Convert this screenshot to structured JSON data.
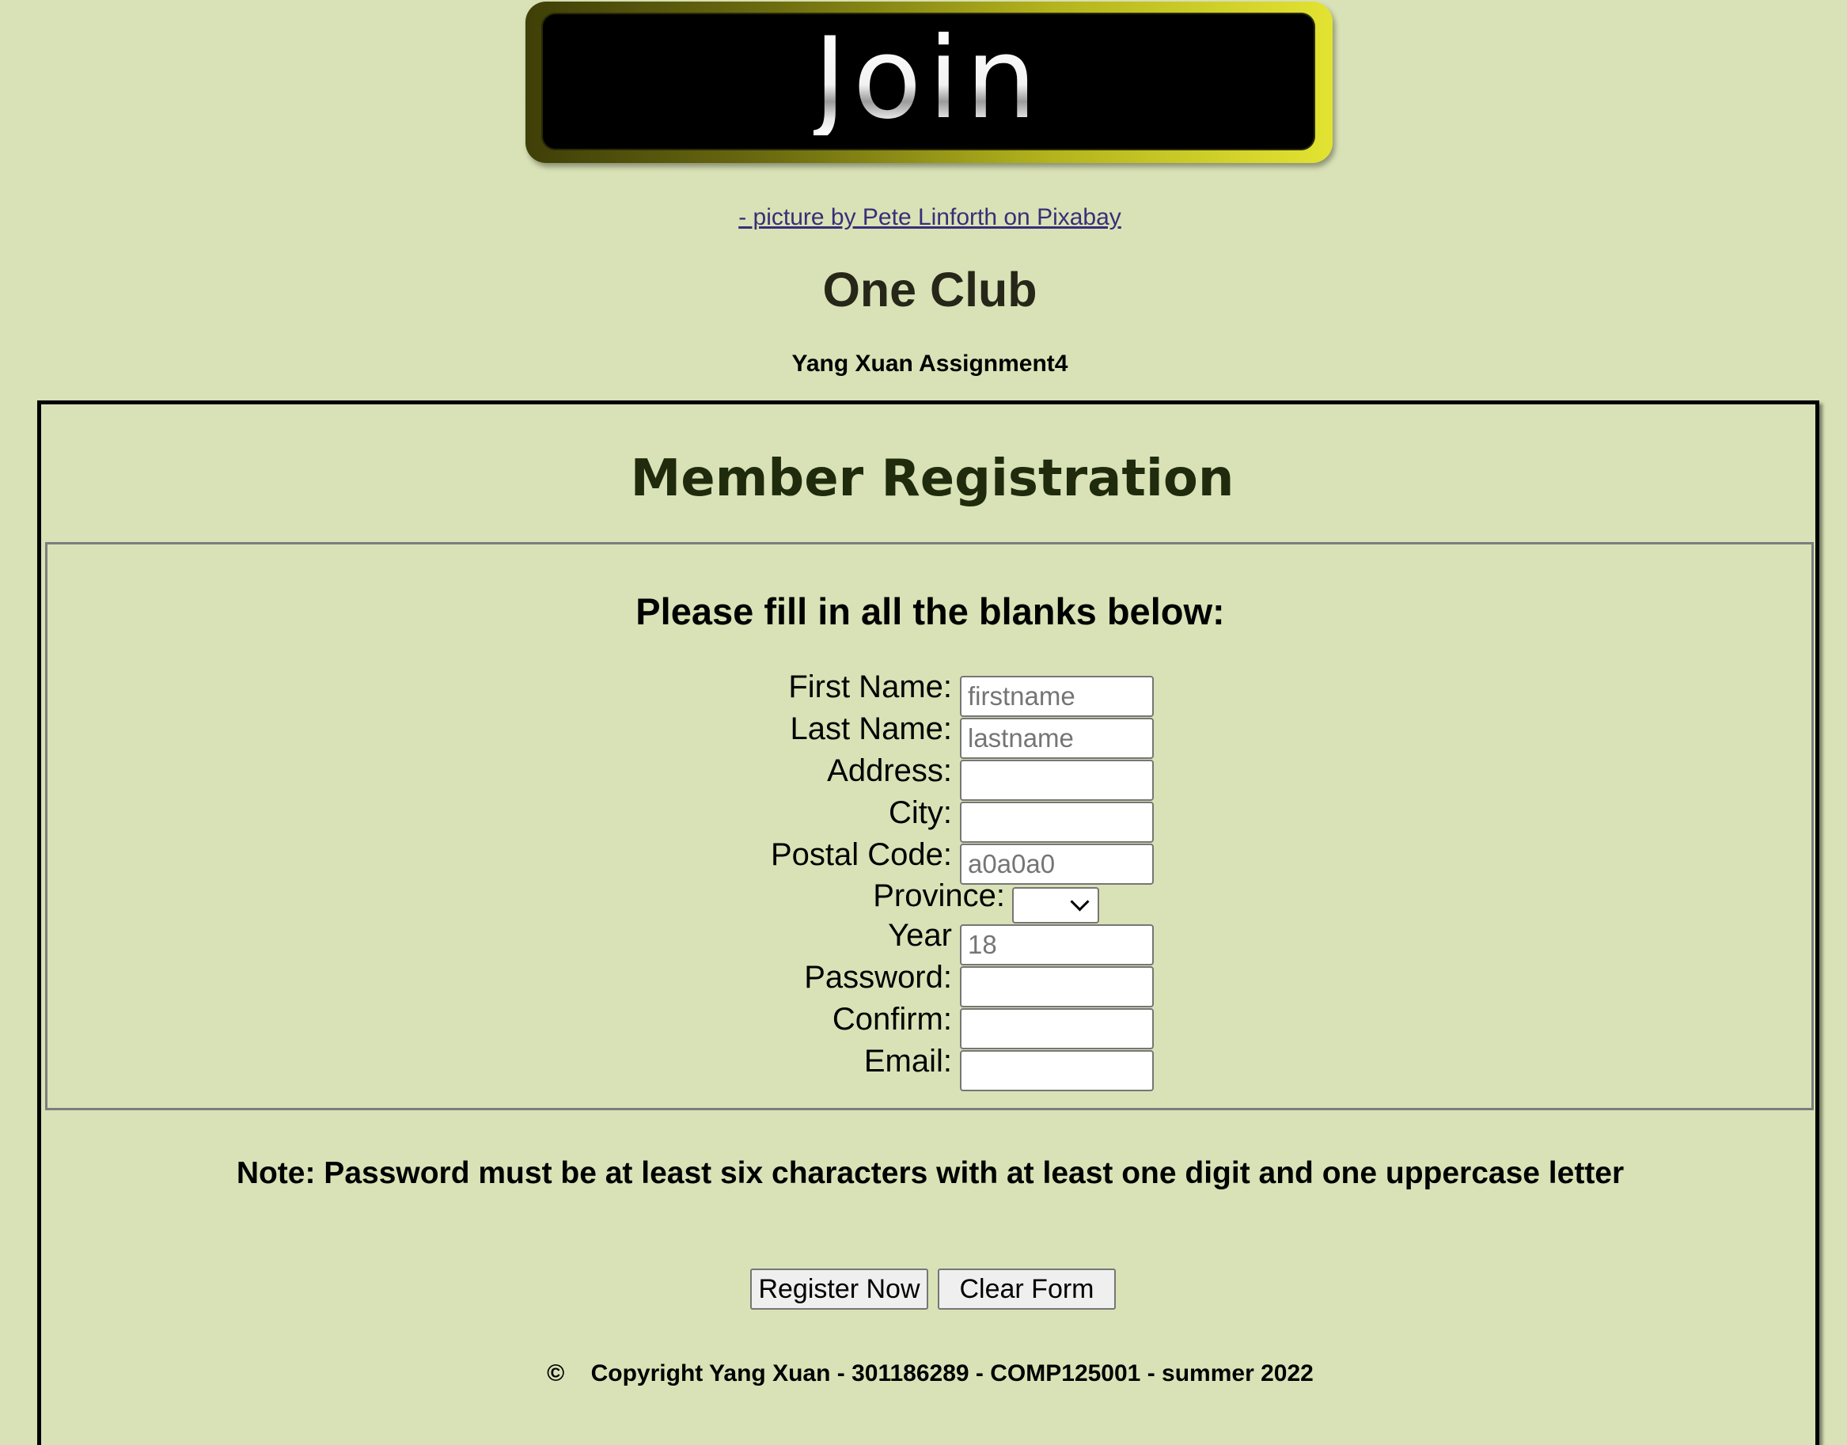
{
  "banner": {
    "text": "Join"
  },
  "credit": {
    "link_text": "- picture by Pete Linforth on Pixabay"
  },
  "header": {
    "title": "One Club",
    "subtitle": "Yang Xuan Assignment4"
  },
  "form": {
    "title": "Member Registration",
    "instructions": "Please fill in all the blanks below:",
    "fields": {
      "first_name": {
        "label": "First Name:",
        "value": "",
        "placeholder": "firstname"
      },
      "last_name": {
        "label": "Last Name:",
        "value": "",
        "placeholder": "lastname"
      },
      "address": {
        "label": "Address:",
        "value": "",
        "placeholder": ""
      },
      "city": {
        "label": "City:",
        "value": "",
        "placeholder": ""
      },
      "postal_code": {
        "label": "Postal Code:",
        "value": "",
        "placeholder": "a0a0a0"
      },
      "province": {
        "label": "Province:",
        "selected": ""
      },
      "year": {
        "label": "Year",
        "value": "",
        "placeholder": "18"
      },
      "password": {
        "label": "Password:",
        "value": "",
        "placeholder": ""
      },
      "confirm": {
        "label": "Confirm:",
        "value": "",
        "placeholder": ""
      },
      "email": {
        "label": "Email:",
        "value": "",
        "placeholder": ""
      }
    },
    "note": "Note: Password must be at least six characters with at least one digit and one uppercase letter",
    "buttons": {
      "register": "Register Now",
      "clear": "Clear Form"
    }
  },
  "footer": {
    "copyright": "©    Copyright Yang Xuan - 301186289 - COMP125001 - summer 2022"
  },
  "colors": {
    "page_background": "#d9e2b6",
    "banner_gold": "#e3e332",
    "link": "#3a2d78",
    "title_text": "#1f2b0c"
  }
}
